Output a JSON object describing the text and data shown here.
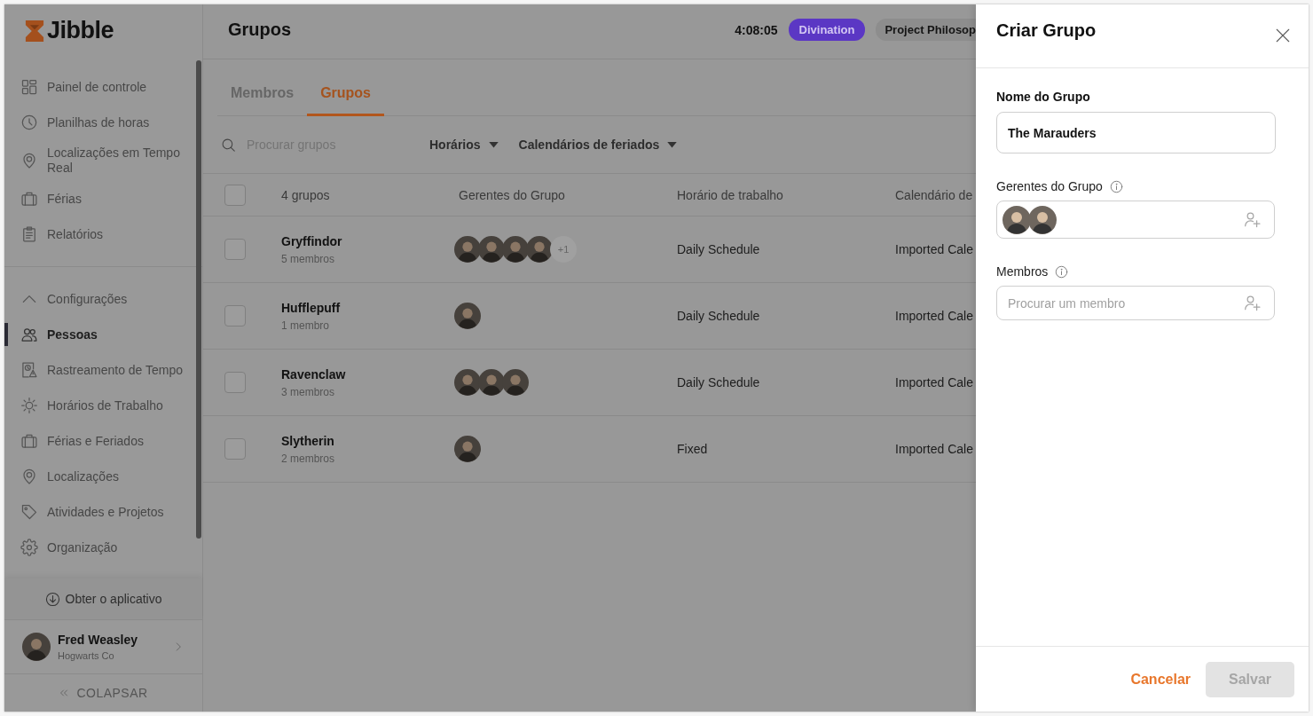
{
  "sidebar": {
    "logo": "Jibble",
    "items": [
      {
        "label": "Painel de controle",
        "selected": false
      },
      {
        "label": "Planilhas de horas",
        "selected": false
      },
      {
        "label": "Localizações em Tempo Real",
        "selected": false
      },
      {
        "label": "Férias",
        "selected": false
      },
      {
        "label": "Relatórios",
        "selected": false
      }
    ],
    "settings": {
      "label": "Configurações",
      "expanded": true,
      "items": [
        {
          "label": "Pessoas",
          "selected": true
        },
        {
          "label": "Rastreamento de Tempo",
          "selected": false
        },
        {
          "label": "Horários de Trabalho",
          "selected": false
        },
        {
          "label": "Férias e Feriados",
          "selected": false
        },
        {
          "label": "Localizações",
          "selected": false
        },
        {
          "label": "Atividades e Projetos",
          "selected": false
        },
        {
          "label": "Organização",
          "selected": false
        }
      ]
    },
    "get_app": "Obter o aplicativo",
    "user": {
      "name": "Fred Weasley",
      "org": "Hogwarts Co"
    },
    "collapse": "COLAPSAR"
  },
  "header": {
    "title": "Grupos",
    "timer": "4:08:05",
    "activity": "Divination",
    "project": "Project Philosop"
  },
  "tabs": [
    {
      "label": "Membros",
      "selected": false
    },
    {
      "label": "Grupos",
      "selected": true
    }
  ],
  "filters": {
    "search": {
      "placeholder": "Procurar grupos"
    },
    "dropdowns": [
      "Horários",
      "Calendários de feriados"
    ]
  },
  "table": {
    "select_all": {
      "checked": false
    },
    "columns": [
      "4 grupos",
      "Gerentes do Grupo",
      "Horário de trabalho",
      "Calendário de"
    ],
    "rows": [
      {
        "checked": false,
        "name": "Gryffindor",
        "members": "5 membros",
        "managers": [
          {
            "kind": "photo"
          },
          {
            "kind": "photo"
          },
          {
            "kind": "photo"
          },
          {
            "kind": "photo"
          }
        ],
        "more_managers": "+1",
        "schedule": "Daily Schedule",
        "calendar": "Imported Cale"
      },
      {
        "checked": false,
        "name": "Hufflepuff",
        "members": "1 membro",
        "managers": [
          {
            "kind": "photo"
          }
        ],
        "schedule": "Daily Schedule",
        "calendar": "Imported Cale"
      },
      {
        "checked": false,
        "name": "Ravenclaw",
        "members": "3 membros",
        "managers": [
          {
            "kind": "photo"
          },
          {
            "kind": "photo"
          },
          {
            "kind": "photo"
          }
        ],
        "schedule": "Daily Schedule",
        "calendar": "Imported Cale"
      },
      {
        "checked": false,
        "name": "Slytherin",
        "members": "2 membros",
        "managers": [
          {
            "kind": "photo"
          }
        ],
        "schedule": "Fixed",
        "calendar": "Imported Cale"
      }
    ]
  },
  "panel": {
    "title": "Criar Grupo",
    "fields": [
      {
        "kind": "text",
        "label": "Nome do Grupo",
        "info": false,
        "value": "The Marauders"
      },
      {
        "kind": "people",
        "label": "Gerentes do Grupo",
        "info": true,
        "avatars": [
          {
            "kind": "photo"
          },
          {
            "kind": "photo"
          }
        ]
      },
      {
        "kind": "people",
        "label": "Membros",
        "info": true,
        "placeholder": "Procurar um membro"
      }
    ],
    "cancel": "Cancelar",
    "save": {
      "label": "Salvar",
      "disabled": true
    }
  }
}
